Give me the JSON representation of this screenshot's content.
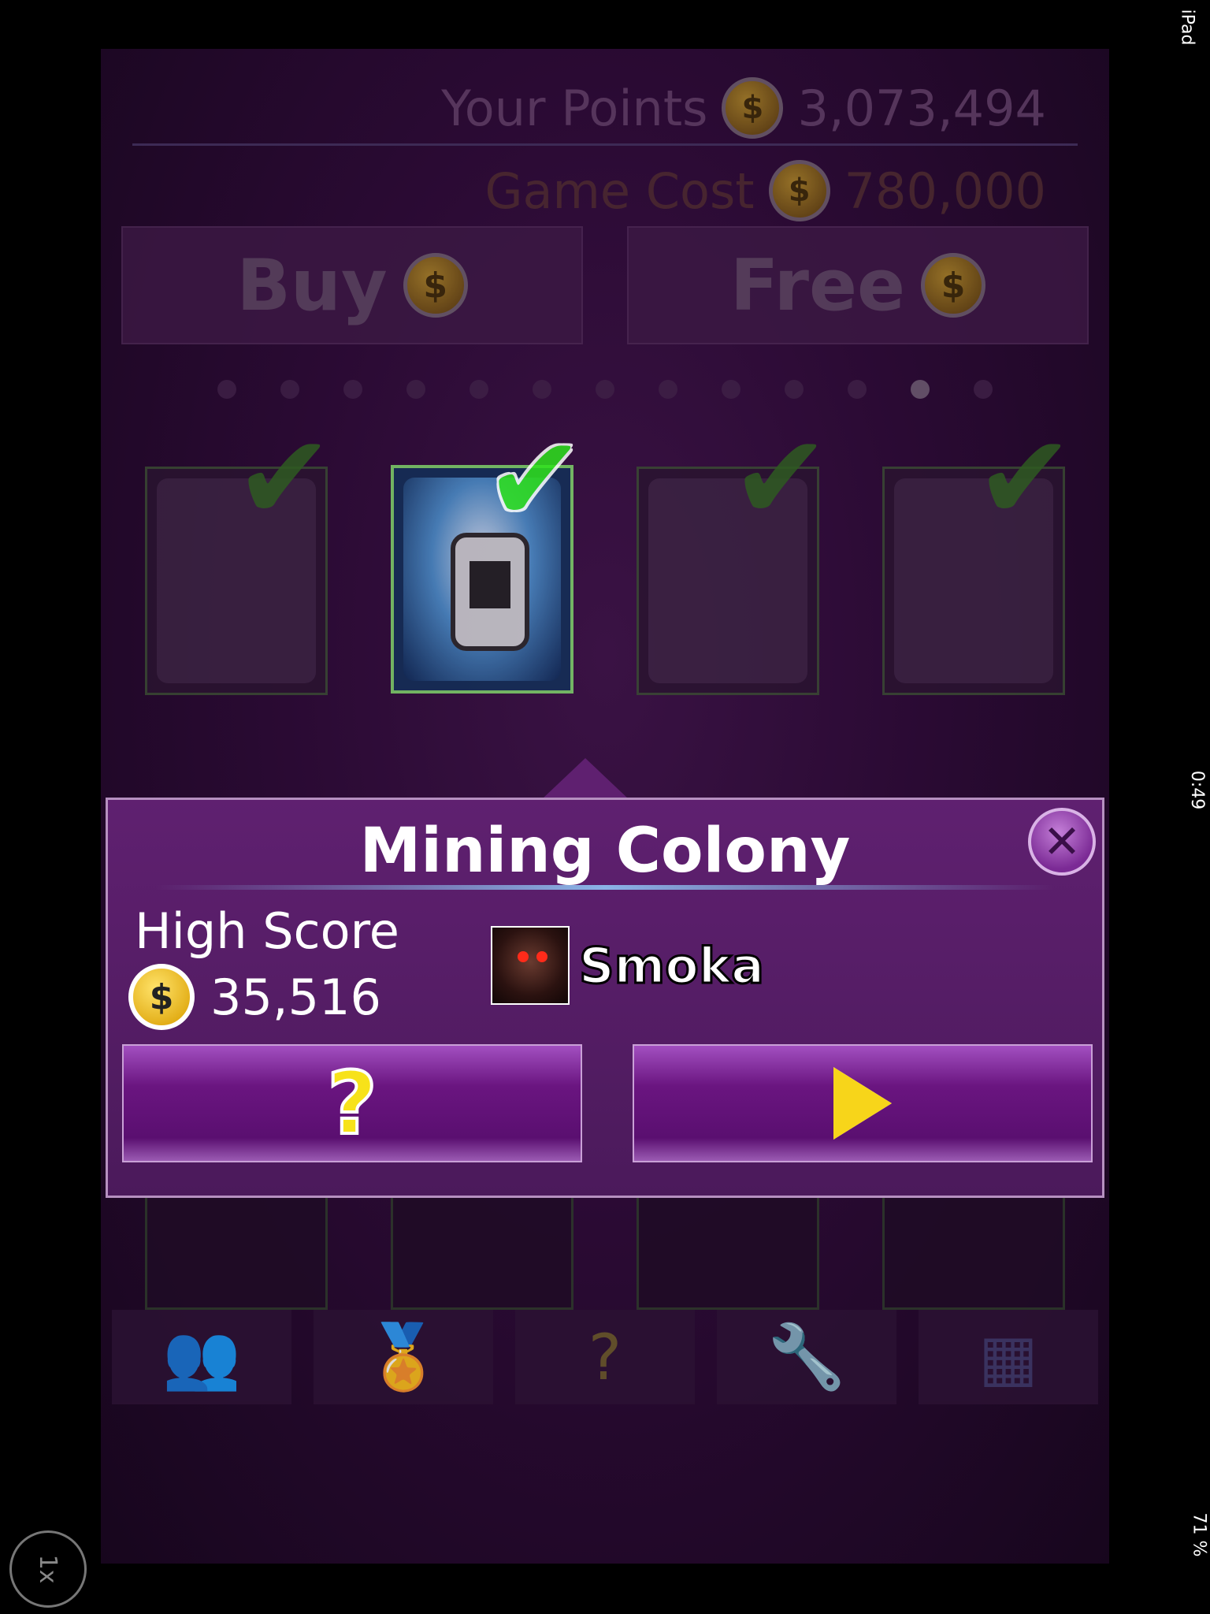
{
  "status_bar": {
    "device": "iPad",
    "time": "0:49",
    "battery": "71 %"
  },
  "zoom_button": {
    "label": "1x"
  },
  "header": {
    "points_label": "Your Points",
    "points_value": "3,073,494",
    "cost_label": "Game Cost",
    "cost_value": "780,000"
  },
  "buttons": {
    "buy_label": "Buy",
    "free_label": "Free"
  },
  "pager": {
    "count": 13,
    "active_index": 11
  },
  "popup": {
    "title": "Mining Colony",
    "high_score_label": "High Score",
    "high_score_value": "35,516",
    "player_name": "Smoka",
    "close_symbol": "✕",
    "help_symbol": "?"
  },
  "nav": {
    "icons": [
      "friends-icon",
      "medal-icon",
      "help-icon",
      "wrench-icon",
      "mini-map-icon"
    ]
  },
  "colors": {
    "popup_bg": "#5f2070",
    "accent_yellow": "#f7e21a",
    "check_green": "#2ee31c"
  }
}
